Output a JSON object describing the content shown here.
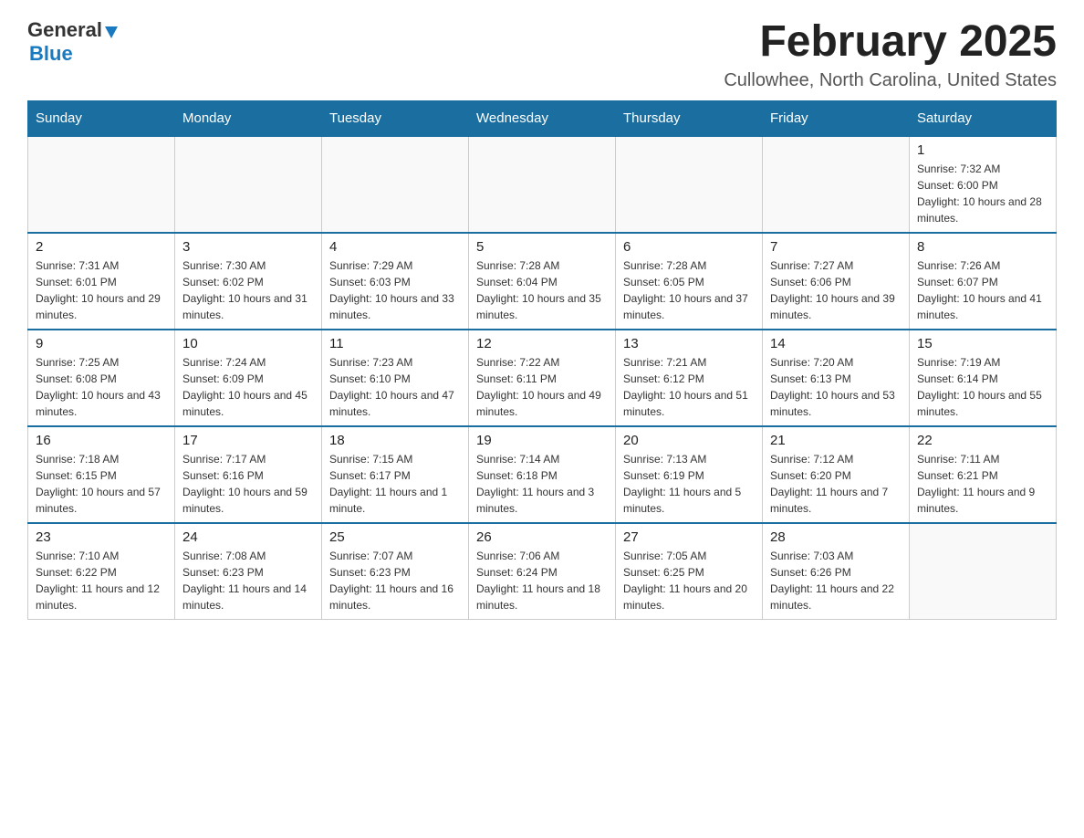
{
  "header": {
    "logo_general": "General",
    "logo_blue": "Blue",
    "month_title": "February 2025",
    "location": "Cullowhee, North Carolina, United States"
  },
  "weekdays": [
    "Sunday",
    "Monday",
    "Tuesday",
    "Wednesday",
    "Thursday",
    "Friday",
    "Saturday"
  ],
  "weeks": [
    [
      {
        "day": "",
        "sunrise": "",
        "sunset": "",
        "daylight": ""
      },
      {
        "day": "",
        "sunrise": "",
        "sunset": "",
        "daylight": ""
      },
      {
        "day": "",
        "sunrise": "",
        "sunset": "",
        "daylight": ""
      },
      {
        "day": "",
        "sunrise": "",
        "sunset": "",
        "daylight": ""
      },
      {
        "day": "",
        "sunrise": "",
        "sunset": "",
        "daylight": ""
      },
      {
        "day": "",
        "sunrise": "",
        "sunset": "",
        "daylight": ""
      },
      {
        "day": "1",
        "sunrise": "Sunrise: 7:32 AM",
        "sunset": "Sunset: 6:00 PM",
        "daylight": "Daylight: 10 hours and 28 minutes."
      }
    ],
    [
      {
        "day": "2",
        "sunrise": "Sunrise: 7:31 AM",
        "sunset": "Sunset: 6:01 PM",
        "daylight": "Daylight: 10 hours and 29 minutes."
      },
      {
        "day": "3",
        "sunrise": "Sunrise: 7:30 AM",
        "sunset": "Sunset: 6:02 PM",
        "daylight": "Daylight: 10 hours and 31 minutes."
      },
      {
        "day": "4",
        "sunrise": "Sunrise: 7:29 AM",
        "sunset": "Sunset: 6:03 PM",
        "daylight": "Daylight: 10 hours and 33 minutes."
      },
      {
        "day": "5",
        "sunrise": "Sunrise: 7:28 AM",
        "sunset": "Sunset: 6:04 PM",
        "daylight": "Daylight: 10 hours and 35 minutes."
      },
      {
        "day": "6",
        "sunrise": "Sunrise: 7:28 AM",
        "sunset": "Sunset: 6:05 PM",
        "daylight": "Daylight: 10 hours and 37 minutes."
      },
      {
        "day": "7",
        "sunrise": "Sunrise: 7:27 AM",
        "sunset": "Sunset: 6:06 PM",
        "daylight": "Daylight: 10 hours and 39 minutes."
      },
      {
        "day": "8",
        "sunrise": "Sunrise: 7:26 AM",
        "sunset": "Sunset: 6:07 PM",
        "daylight": "Daylight: 10 hours and 41 minutes."
      }
    ],
    [
      {
        "day": "9",
        "sunrise": "Sunrise: 7:25 AM",
        "sunset": "Sunset: 6:08 PM",
        "daylight": "Daylight: 10 hours and 43 minutes."
      },
      {
        "day": "10",
        "sunrise": "Sunrise: 7:24 AM",
        "sunset": "Sunset: 6:09 PM",
        "daylight": "Daylight: 10 hours and 45 minutes."
      },
      {
        "day": "11",
        "sunrise": "Sunrise: 7:23 AM",
        "sunset": "Sunset: 6:10 PM",
        "daylight": "Daylight: 10 hours and 47 minutes."
      },
      {
        "day": "12",
        "sunrise": "Sunrise: 7:22 AM",
        "sunset": "Sunset: 6:11 PM",
        "daylight": "Daylight: 10 hours and 49 minutes."
      },
      {
        "day": "13",
        "sunrise": "Sunrise: 7:21 AM",
        "sunset": "Sunset: 6:12 PM",
        "daylight": "Daylight: 10 hours and 51 minutes."
      },
      {
        "day": "14",
        "sunrise": "Sunrise: 7:20 AM",
        "sunset": "Sunset: 6:13 PM",
        "daylight": "Daylight: 10 hours and 53 minutes."
      },
      {
        "day": "15",
        "sunrise": "Sunrise: 7:19 AM",
        "sunset": "Sunset: 6:14 PM",
        "daylight": "Daylight: 10 hours and 55 minutes."
      }
    ],
    [
      {
        "day": "16",
        "sunrise": "Sunrise: 7:18 AM",
        "sunset": "Sunset: 6:15 PM",
        "daylight": "Daylight: 10 hours and 57 minutes."
      },
      {
        "day": "17",
        "sunrise": "Sunrise: 7:17 AM",
        "sunset": "Sunset: 6:16 PM",
        "daylight": "Daylight: 10 hours and 59 minutes."
      },
      {
        "day": "18",
        "sunrise": "Sunrise: 7:15 AM",
        "sunset": "Sunset: 6:17 PM",
        "daylight": "Daylight: 11 hours and 1 minute."
      },
      {
        "day": "19",
        "sunrise": "Sunrise: 7:14 AM",
        "sunset": "Sunset: 6:18 PM",
        "daylight": "Daylight: 11 hours and 3 minutes."
      },
      {
        "day": "20",
        "sunrise": "Sunrise: 7:13 AM",
        "sunset": "Sunset: 6:19 PM",
        "daylight": "Daylight: 11 hours and 5 minutes."
      },
      {
        "day": "21",
        "sunrise": "Sunrise: 7:12 AM",
        "sunset": "Sunset: 6:20 PM",
        "daylight": "Daylight: 11 hours and 7 minutes."
      },
      {
        "day": "22",
        "sunrise": "Sunrise: 7:11 AM",
        "sunset": "Sunset: 6:21 PM",
        "daylight": "Daylight: 11 hours and 9 minutes."
      }
    ],
    [
      {
        "day": "23",
        "sunrise": "Sunrise: 7:10 AM",
        "sunset": "Sunset: 6:22 PM",
        "daylight": "Daylight: 11 hours and 12 minutes."
      },
      {
        "day": "24",
        "sunrise": "Sunrise: 7:08 AM",
        "sunset": "Sunset: 6:23 PM",
        "daylight": "Daylight: 11 hours and 14 minutes."
      },
      {
        "day": "25",
        "sunrise": "Sunrise: 7:07 AM",
        "sunset": "Sunset: 6:23 PM",
        "daylight": "Daylight: 11 hours and 16 minutes."
      },
      {
        "day": "26",
        "sunrise": "Sunrise: 7:06 AM",
        "sunset": "Sunset: 6:24 PM",
        "daylight": "Daylight: 11 hours and 18 minutes."
      },
      {
        "day": "27",
        "sunrise": "Sunrise: 7:05 AM",
        "sunset": "Sunset: 6:25 PM",
        "daylight": "Daylight: 11 hours and 20 minutes."
      },
      {
        "day": "28",
        "sunrise": "Sunrise: 7:03 AM",
        "sunset": "Sunset: 6:26 PM",
        "daylight": "Daylight: 11 hours and 22 minutes."
      },
      {
        "day": "",
        "sunrise": "",
        "sunset": "",
        "daylight": ""
      }
    ]
  ]
}
